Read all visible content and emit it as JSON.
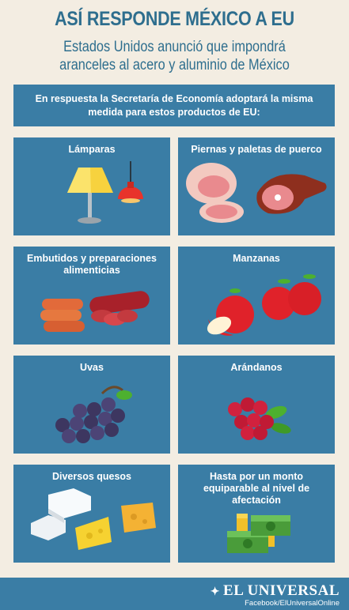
{
  "header": {
    "title": "ASÍ RESPONDE MÉXICO A EU",
    "subtitle": "Estados Unidos anunció que impondrá aranceles al acero y aluminio de México"
  },
  "banner": "En respuesta la Secretaría de Economía adoptará la misma medida para estos productos de EU:",
  "tiles": [
    {
      "label": "Lámparas",
      "icon": "lamps-icon"
    },
    {
      "label": "Piernas y paletas de puerco",
      "icon": "ham-icon"
    },
    {
      "label": "Embutidos y preparaciones alimenticias",
      "icon": "sausages-icon"
    },
    {
      "label": "Manzanas",
      "icon": "apples-icon"
    },
    {
      "label": "Uvas",
      "icon": "grapes-icon"
    },
    {
      "label": "Arándanos",
      "icon": "cranberries-icon"
    },
    {
      "label": "Diversos quesos",
      "icon": "cheese-icon"
    },
    {
      "label": "Hasta por un monto equiparable al nivel de afectación",
      "icon": "money-icon"
    }
  ],
  "footer": {
    "logo": "EL UNIVERSAL",
    "social": "Facebook/ElUniversalOnline"
  },
  "colors": {
    "accent": "#2e6e8e",
    "tile": "#3a7da5",
    "background": "#f3ede2"
  }
}
